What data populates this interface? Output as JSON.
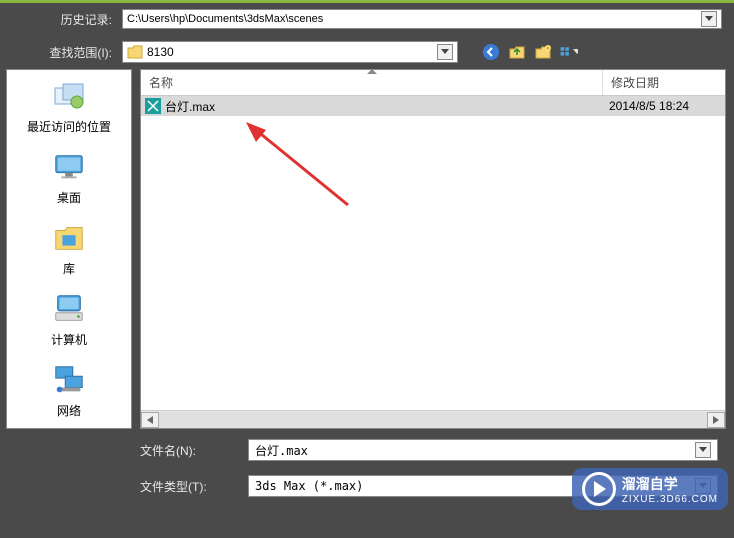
{
  "history": {
    "label": "历史记录:",
    "path": "C:\\Users\\hp\\Documents\\3dsMax\\scenes"
  },
  "lookin": {
    "label": "查找范围(I):",
    "folder": "8130"
  },
  "sidebar": {
    "items": [
      {
        "label": "最近访问的位置"
      },
      {
        "label": "桌面"
      },
      {
        "label": "库"
      },
      {
        "label": "计算机"
      },
      {
        "label": "网络"
      }
    ]
  },
  "file_list": {
    "columns": {
      "name": "名称",
      "date": "修改日期"
    },
    "rows": [
      {
        "name": "台灯.max",
        "date": "2014/8/5 18:24"
      }
    ]
  },
  "filename": {
    "label": "文件名(N):",
    "value": "台灯.max"
  },
  "filetype": {
    "label": "文件类型(T):",
    "value": "3ds Max (*.max)"
  },
  "watermark": {
    "title": "溜溜自学",
    "sub": "ZIXUE.3D66.COM"
  }
}
